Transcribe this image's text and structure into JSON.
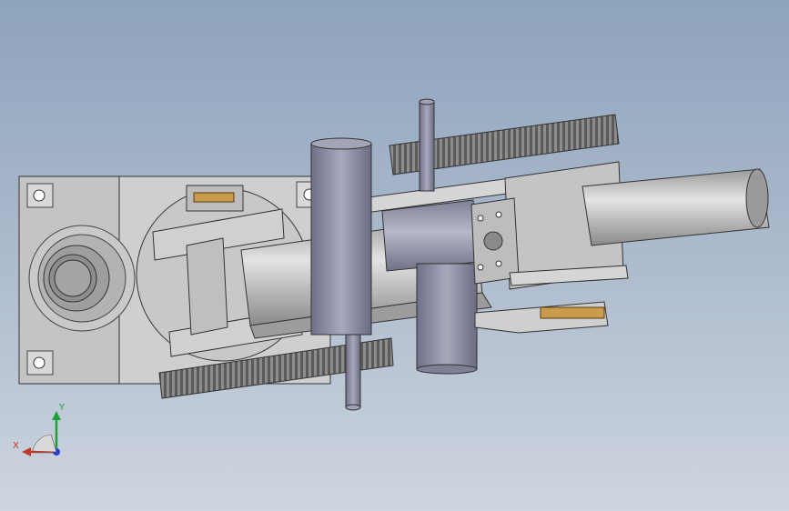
{
  "viewport": {
    "background_top": "#8ea3bd",
    "background_bottom": "#cdd5df",
    "model_description": "mechanical-assembly"
  },
  "triad": {
    "x_label": "X",
    "y_label": "Y",
    "x_color": "#c0392b",
    "y_color": "#1f9e3a",
    "z_color": "#2b3fd1"
  },
  "colors": {
    "housing_fill": "#cbcbcb",
    "cylinder_fill": "#9fa0b4",
    "gear_fill": "#8e8e8e",
    "accent_gold": "#c89b4d"
  }
}
